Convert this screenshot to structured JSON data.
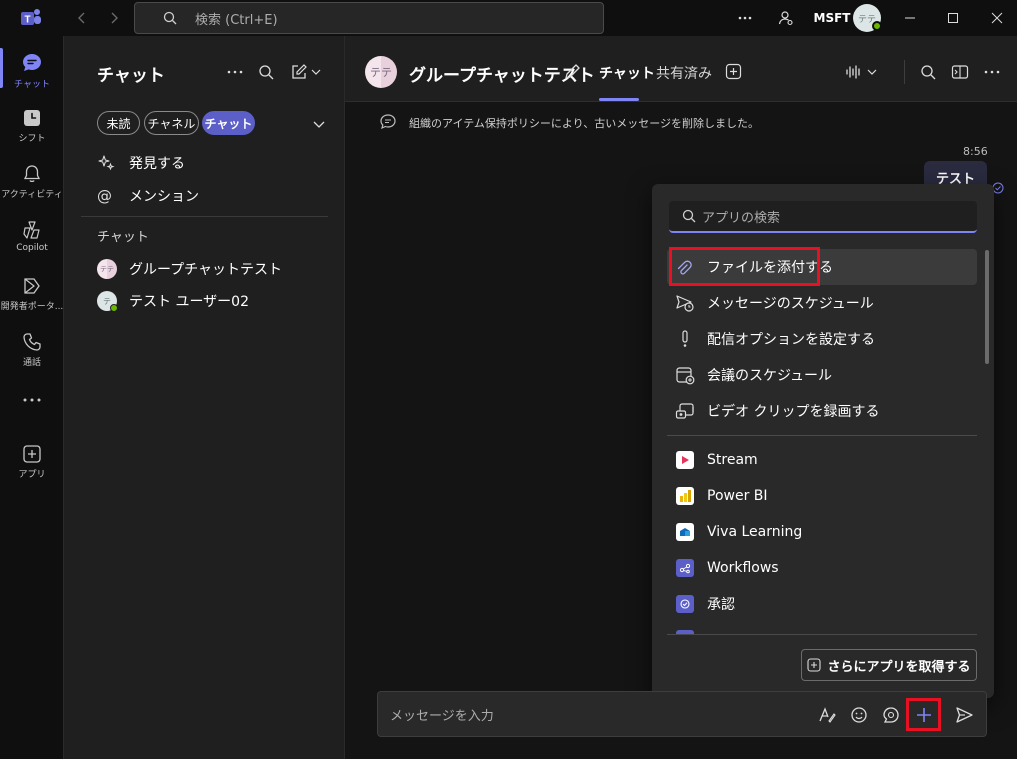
{
  "titlebar": {
    "search_placeholder": "検索 (Ctrl+E)",
    "org_name": "MSFT",
    "avatar_initials": "テテ"
  },
  "rail": {
    "items": [
      {
        "label": "チャット",
        "icon": "chat-icon"
      },
      {
        "label": "シフト",
        "icon": "shifts-icon"
      },
      {
        "label": "アクティビティ",
        "icon": "bell-icon"
      },
      {
        "label": "Copilot",
        "icon": "copilot-icon"
      },
      {
        "label": "開発者ポータ...",
        "icon": "developer-portal-icon"
      },
      {
        "label": "通話",
        "icon": "phone-icon"
      },
      {
        "label": "アプリ",
        "icon": "add-app-icon"
      }
    ]
  },
  "chatpane": {
    "title": "チャット",
    "filters": [
      "未読",
      "チャネル",
      "チャット"
    ],
    "discover": "発見する",
    "mentions": "メンション",
    "section_label": "チャット",
    "chats": [
      {
        "name": "グループチャットテスト",
        "initials": "テテ"
      },
      {
        "name": "テスト ユーザー02",
        "initials": "テ"
      }
    ]
  },
  "header": {
    "avatar_initials": "テテ",
    "title": "グループチャットテスト",
    "tabs": [
      "チャット",
      "共有済み"
    ]
  },
  "main": {
    "system_message": "組織のアイテム保持ポリシーにより、古いメッセージを削除しました。",
    "message_time": "8:56",
    "message_text": "テスト"
  },
  "popup": {
    "search_placeholder": "アプリの検索",
    "actions": [
      {
        "label": "ファイルを添付する",
        "icon": "paperclip-icon"
      },
      {
        "label": "メッセージのスケジュール",
        "icon": "schedule-send-icon"
      },
      {
        "label": "配信オプションを設定する",
        "icon": "exclamation-icon"
      },
      {
        "label": "会議のスケジュール",
        "icon": "calendar-add-icon"
      },
      {
        "label": "ビデオ クリップを録画する",
        "icon": "video-clip-icon"
      }
    ],
    "apps": [
      {
        "label": "Stream",
        "icon": "stream-icon",
        "color": "#e8345a"
      },
      {
        "label": "Power BI",
        "icon": "powerbi-icon",
        "color": "#f2c811"
      },
      {
        "label": "Viva Learning",
        "icon": "viva-learning-icon",
        "color": "#0f6cbd"
      },
      {
        "label": "Workflows",
        "icon": "workflows-icon",
        "color": "#5b5fc7"
      },
      {
        "label": "承認",
        "icon": "approvals-icon",
        "color": "#5b5fc7"
      }
    ],
    "get_more_apps": "さらにアプリを取得する"
  },
  "composer": {
    "placeholder": "メッセージを入力"
  },
  "colors": {
    "accent": "#7f85f5",
    "highlight": "#e81123"
  }
}
